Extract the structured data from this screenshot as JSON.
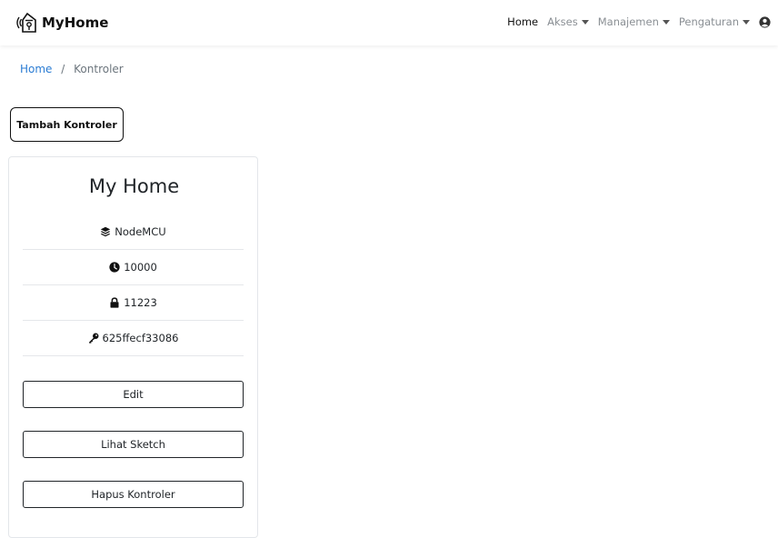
{
  "navbar": {
    "brand": "MyHome",
    "links": [
      {
        "label": "Home"
      },
      {
        "label": "Akses"
      },
      {
        "label": "Manajemen"
      },
      {
        "label": "Pengaturan"
      }
    ]
  },
  "breadcrumb": {
    "home": "Home",
    "separator": "/",
    "current": "Kontroler"
  },
  "add_button": "Tambah Kontroler",
  "controller_card": {
    "title": "My Home",
    "board": "NodeMCU",
    "interval": "10000",
    "pin": "11223",
    "key": "625ffecf33086",
    "edit_label": "Edit",
    "sketch_label": "Lihat Sketch",
    "delete_label": "Hapus Kontroler"
  },
  "colors": {
    "link": "#2b7cd3",
    "text": "#212529",
    "muted": "#8a8f94"
  }
}
